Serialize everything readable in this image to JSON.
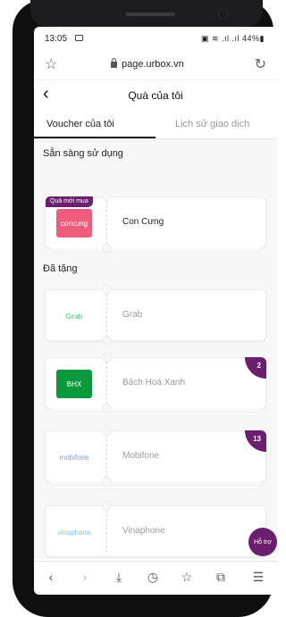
{
  "status_bar": {
    "time": "13:05",
    "indicators": "▣ ≋ .ıl .ıl 44%▮"
  },
  "browser": {
    "url": "page.urbox.vn",
    "star_icon": "☆",
    "reload_icon": "↻"
  },
  "header": {
    "back_icon": "‹",
    "title": "Quà của tôi"
  },
  "tabs": [
    {
      "label": "Voucher của tôi",
      "active": true
    },
    {
      "label": "Lịch sử giao dịch",
      "active": false
    }
  ],
  "sections": {
    "ready": "Sẵn sàng sử dụng",
    "gifted": "Đã tặng"
  },
  "vouchers_ready": [
    {
      "name": "Con Cưng",
      "badge": "Quà mới mua",
      "logo_text": "concung",
      "logo_color": "#ef5d7c"
    }
  ],
  "vouchers_gifted": [
    {
      "name": "Grab",
      "logo_text": "Grab",
      "count": ""
    },
    {
      "name": "Bách Hoá Xanh",
      "logo_text": "BHX",
      "count": "2"
    },
    {
      "name": "Mobifone",
      "logo_text": "mobifone",
      "count": "13"
    },
    {
      "name": "Vinaphone",
      "logo_text": "vinaphone",
      "count": ""
    }
  ],
  "support_label": "Hỗ trợ",
  "bottom_nav": [
    "‹",
    "›",
    "⤓",
    "◷",
    "☆",
    "⧉",
    "☰"
  ],
  "accent_color": "#6c1f6e"
}
